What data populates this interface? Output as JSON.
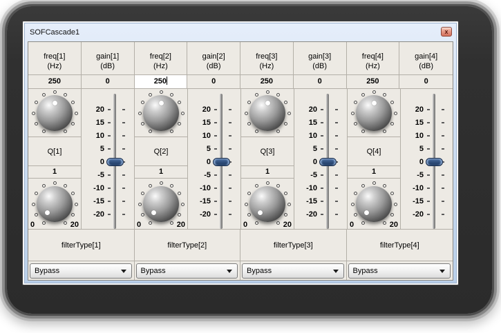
{
  "window": {
    "title": "SOFCascade1",
    "close_glyph": "x"
  },
  "channels": [
    {
      "freq_label": "freq[1]",
      "freq_unit": "(Hz)",
      "freq_value": "250",
      "gain_label": "gain[1]",
      "gain_unit": "(dB)",
      "gain_value": "0",
      "q_label": "Q[1]",
      "q_value": "1",
      "q_knob_min": "0",
      "q_knob_max": "20",
      "filter_type_label": "filterType[1]",
      "filter_type_value": "Bypass"
    },
    {
      "freq_label": "freq[2]",
      "freq_unit": "(Hz)",
      "freq_value": "250",
      "freq_editing": true,
      "gain_label": "gain[2]",
      "gain_unit": "(dB)",
      "gain_value": "0",
      "q_label": "Q[2]",
      "q_value": "1",
      "q_knob_min": "0",
      "q_knob_max": "20",
      "filter_type_label": "filterType[2]",
      "filter_type_value": "Bypass"
    },
    {
      "freq_label": "freq[3]",
      "freq_unit": "(Hz)",
      "freq_value": "250",
      "gain_label": "gain[3]",
      "gain_unit": "(dB)",
      "gain_value": "0",
      "q_label": "Q[3]",
      "q_value": "1",
      "q_knob_min": "0",
      "q_knob_max": "20",
      "filter_type_label": "filterType[3]",
      "filter_type_value": "Bypass"
    },
    {
      "freq_label": "freq[4]",
      "freq_unit": "(Hz)",
      "freq_value": "250",
      "gain_label": "gain[4]",
      "gain_unit": "(dB)",
      "gain_value": "0",
      "q_label": "Q[4]",
      "q_value": "1",
      "q_knob_min": "0",
      "q_knob_max": "20",
      "filter_type_label": "filterType[4]",
      "filter_type_value": "Bypass"
    }
  ],
  "slider": {
    "ticks": [
      "20",
      "15",
      "10",
      "5",
      "0",
      "-5",
      "-10",
      "-15",
      "-20"
    ],
    "value": "0"
  },
  "colors": {
    "titlebar_blue": "#c4d7ee",
    "client_gray": "#edeae4",
    "grid_line": "#b3afa7",
    "slider_handle_blue": "#33527f",
    "close_red": "#d4705c"
  }
}
